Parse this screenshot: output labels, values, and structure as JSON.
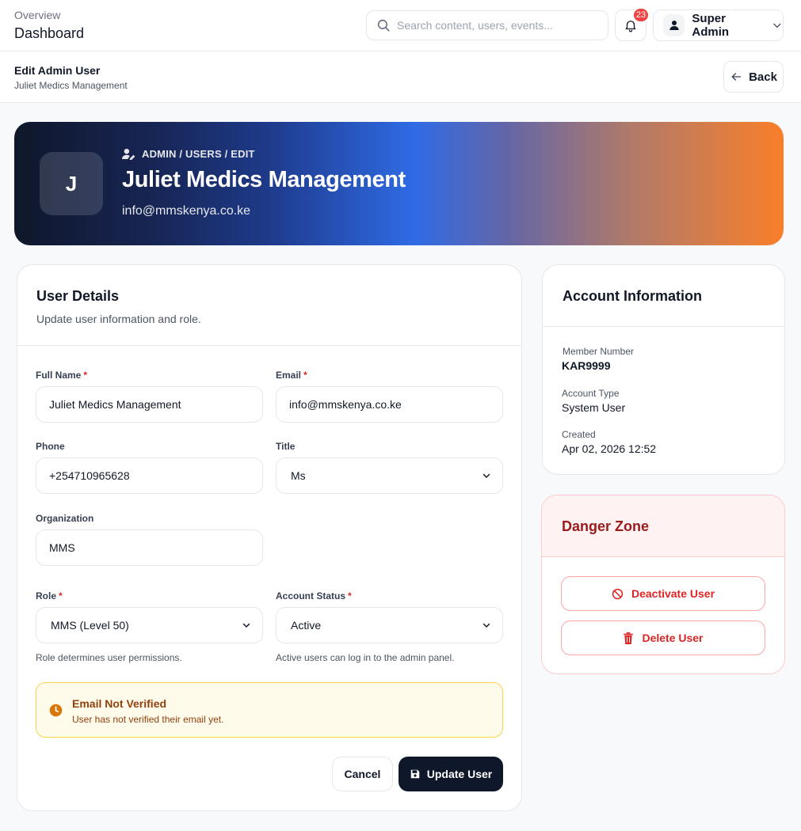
{
  "topbar": {
    "section": "Overview",
    "page": "Dashboard",
    "search_placeholder": "Search content, users, events...",
    "notification_count": "23",
    "user_name": "Super Admin"
  },
  "subheader": {
    "title": "Edit Admin User",
    "subtitle": "Juliet Medics Management",
    "back_label": "Back"
  },
  "hero": {
    "initial": "J",
    "breadcrumb": "ADMIN / USERS / EDIT",
    "name": "Juliet Medics Management",
    "email": "info@mmskenya.co.ke"
  },
  "details": {
    "title": "User Details",
    "description": "Update user information and role.",
    "full_name": {
      "label": "Full Name",
      "required": "*",
      "value": "Juliet Medics Management"
    },
    "email": {
      "label": "Email",
      "required": "*",
      "value": "info@mmskenya.co.ke"
    },
    "phone": {
      "label": "Phone",
      "value": "+254710965628"
    },
    "title_field": {
      "label": "Title",
      "value": "Ms"
    },
    "organization": {
      "label": "Organization",
      "value": "MMS"
    },
    "role": {
      "label": "Role",
      "required": "*",
      "value": "MMS (Level 50)",
      "hint": "Role determines user permissions."
    },
    "status": {
      "label": "Account Status",
      "required": "*",
      "value": "Active",
      "hint": "Active users can log in to the admin panel."
    },
    "alert": {
      "title": "Email Not Verified",
      "message": "User has not verified their email yet."
    },
    "cancel_label": "Cancel",
    "update_label": "Update User"
  },
  "account": {
    "title": "Account Information",
    "member_number_label": "Member Number",
    "member_number": "KAR9999",
    "account_type_label": "Account Type",
    "account_type": "System User",
    "created_label": "Created",
    "created": "Apr 02, 2026 12:52"
  },
  "danger": {
    "title": "Danger Zone",
    "deactivate_label": "Deactivate User",
    "delete_label": "Delete User"
  },
  "colors": {
    "primary": "#0f172a",
    "danger": "#dc2626",
    "warning_bg": "#fffbeb",
    "warning_text": "#92400e",
    "badge": "#ef4444"
  }
}
